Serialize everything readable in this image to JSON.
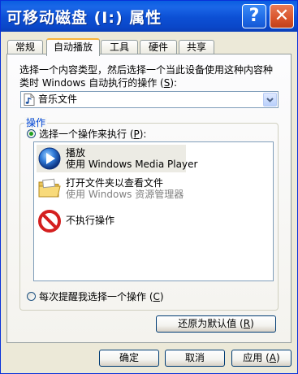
{
  "window": {
    "title": "可移动磁盘 (I:) 属性",
    "help_glyph": "?",
    "close_glyph": "✕"
  },
  "tabs": [
    {
      "label": "常规"
    },
    {
      "label": "自动播放"
    },
    {
      "label": "工具"
    },
    {
      "label": "硬件"
    },
    {
      "label": "共享"
    }
  ],
  "autoplay": {
    "description_line1": "选择一个内容类型，然后选择一个当此设备使用这种内容种",
    "description_line2_prefix": "类时 Windows 自动执行的操作 (",
    "description_line2_key": "S",
    "description_line2_suffix": "):",
    "content_type": {
      "selected": "音乐文件",
      "icon": "music-file-icon"
    },
    "actions_group": {
      "legend": "操作",
      "choose_radio": {
        "prefix": "选择一个操作来执行 (",
        "key": "P",
        "suffix": "):",
        "checked": true
      },
      "items": [
        {
          "title": "播放",
          "subtitle": "使用 Windows Media Player",
          "icon": "windows-media-player-icon",
          "selected": true,
          "gray_subtitle": false
        },
        {
          "title": "打开文件夹以查看文件",
          "subtitle": "使用 Windows 资源管理器",
          "icon": "folder-icon",
          "selected": false,
          "gray_subtitle": true
        },
        {
          "title": "不执行操作",
          "subtitle": "",
          "icon": "no-action-icon",
          "selected": false,
          "gray_subtitle": false
        }
      ],
      "prompt_radio": {
        "prefix": "每次提醒我选择一个操作 (",
        "key": "C",
        "suffix": ")",
        "checked": false
      }
    },
    "restore_button": {
      "prefix": "还原为默认值 (",
      "key": "R",
      "suffix": ")"
    }
  },
  "footer": {
    "ok": "确定",
    "cancel": "取消",
    "apply_prefix": "应用 (",
    "apply_key": "A",
    "apply_suffix": ")"
  },
  "colors": {
    "titlebar": "#0a47c8",
    "face": "#ece9d8",
    "legend_text": "#0046d5",
    "active_tab_accent": "#f8b33a"
  }
}
